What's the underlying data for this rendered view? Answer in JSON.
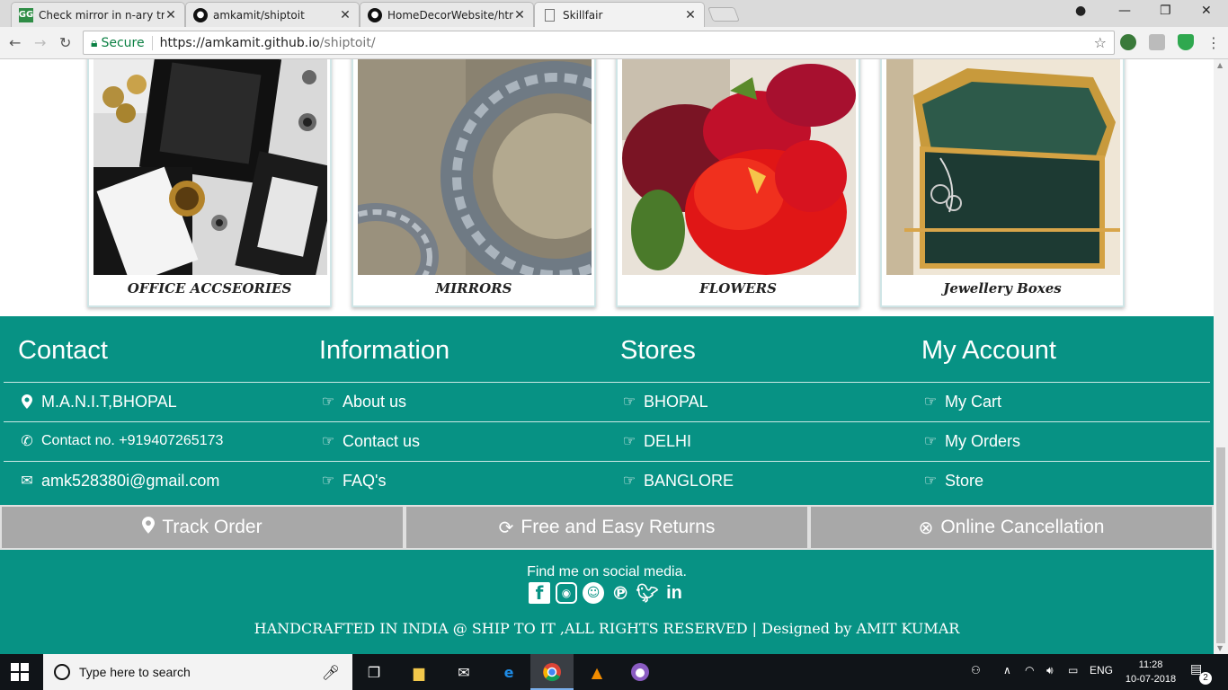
{
  "browser": {
    "tabs": [
      {
        "title": "Check mirror in n-ary tree",
        "favicon": "gfg-icon"
      },
      {
        "title": "amkamit/shiptoit",
        "favicon": "github-icon"
      },
      {
        "title": "HomeDecorWebsite/html",
        "favicon": "github-icon"
      },
      {
        "title": "Skillfair",
        "favicon": "page-icon"
      }
    ],
    "secure_label": "Secure",
    "url_host": "https://amkamit.github.io",
    "url_path": "/shiptoit/"
  },
  "categories": [
    {
      "label": "OFFICE ACCSEORIES"
    },
    {
      "label": "MIRRORS"
    },
    {
      "label": "FLOWERS"
    },
    {
      "label": "Jewellery Boxes"
    }
  ],
  "footer": {
    "columns": [
      {
        "heading": "Contact",
        "items": [
          {
            "icon": "map-marker-icon",
            "label": "M.A.N.I.T,BHOPAL"
          },
          {
            "icon": "phone-icon",
            "label": "Contact no. +919407265173"
          },
          {
            "icon": "envelope-icon",
            "label": "amk528380i@gmail.com"
          }
        ]
      },
      {
        "heading": "Information",
        "items": [
          {
            "icon": "hand-point-icon",
            "label": "About us"
          },
          {
            "icon": "hand-point-icon",
            "label": "Contact us"
          },
          {
            "icon": "hand-point-icon",
            "label": "FAQ's"
          }
        ]
      },
      {
        "heading": "Stores",
        "items": [
          {
            "icon": "hand-point-icon",
            "label": "BHOPAL"
          },
          {
            "icon": "hand-point-icon",
            "label": "DELHI"
          },
          {
            "icon": "hand-point-icon",
            "label": "BANGLORE"
          }
        ]
      },
      {
        "heading": "My Account",
        "items": [
          {
            "icon": "hand-point-icon",
            "label": "My Cart"
          },
          {
            "icon": "hand-point-icon",
            "label": "My Orders"
          },
          {
            "icon": "hand-point-icon",
            "label": "Store"
          }
        ]
      }
    ],
    "features": [
      {
        "icon": "map-marker-icon",
        "label": "Track Order"
      },
      {
        "icon": "refresh-icon",
        "label": "Free and Easy Returns"
      },
      {
        "icon": "cancel-circle-icon",
        "label": "Online Cancellation"
      }
    ],
    "social_text": "Find me on social media.",
    "social_icons": [
      "facebook-icon",
      "instagram-icon",
      "snapchat-icon",
      "pinterest-icon",
      "twitter-icon",
      "linkedin-icon"
    ],
    "copyright": "HANDCRAFTED IN INDIA @ SHIP TO IT ,ALL RIGHTS RESERVED | Designed by AMIT KUMAR"
  },
  "taskbar": {
    "search_placeholder": "Type here to search",
    "language": "ENG",
    "time": "11:28",
    "date": "10-07-2018",
    "notification_count": "2"
  },
  "colors": {
    "footer_bg": "#079284",
    "feature_bar_bg": "#a8a8a8"
  }
}
